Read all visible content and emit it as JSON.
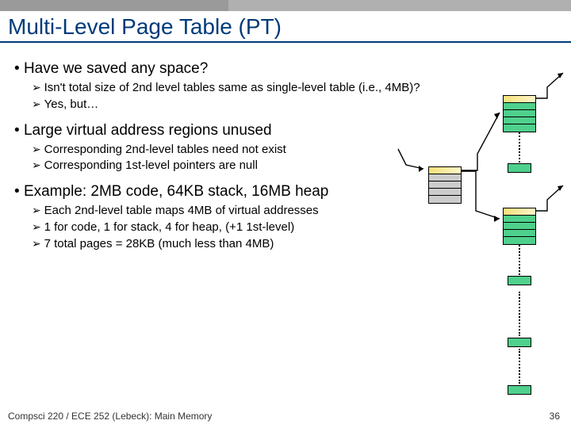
{
  "title": "Multi-Level Page Table (PT)",
  "sections": [
    {
      "heading": "Have we saved any space?",
      "items": [
        "Isn't total size of 2nd level tables same as single-level table (i.e., 4MB)?",
        "Yes, but…"
      ]
    },
    {
      "heading": "Large virtual address regions unused",
      "items": [
        "Corresponding 2nd-level tables need not exist",
        "Corresponding 1st-level pointers are null"
      ]
    },
    {
      "heading": "Example: 2MB code, 64KB stack, 16MB heap",
      "items": [
        "Each 2nd-level table maps 4MB of virtual addresses",
        "1 for code, 1 for stack, 4 for heap, (+1 1st-level)",
        "7 total pages = 28KB (much less than 4MB)"
      ]
    }
  ],
  "footer": "Compsci 220 / ECE 252 (Lebeck): Main Memory",
  "page_number": "36"
}
